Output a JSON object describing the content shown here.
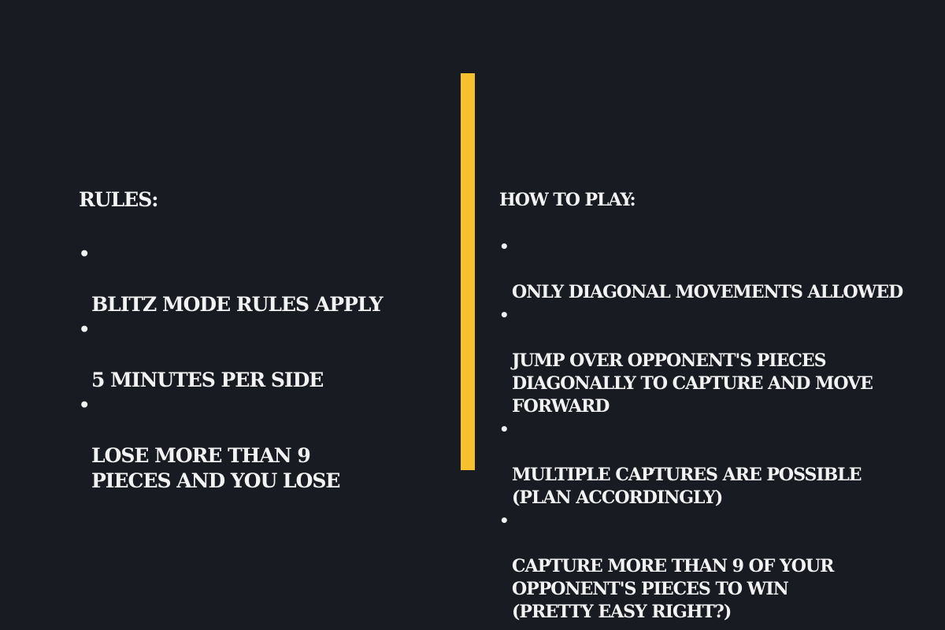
{
  "colors": {
    "background": "#181b21",
    "text": "#f2f2f2",
    "accent": "#f6c12c"
  },
  "rules": {
    "heading": "RULES:",
    "items": [
      "BLITZ MODE RULES APPLY",
      "5 MINUTES PER SIDE",
      "LOSE MORE THAN 9\nPIECES AND YOU LOSE"
    ]
  },
  "how_to_play": {
    "heading": "HOW TO PLAY:",
    "items": [
      "ONLY DIAGONAL MOVEMENTS ALLOWED",
      "JUMP OVER OPPONENT'S PIECES\nDIAGONALLY TO CAPTURE AND MOVE\nFORWARD",
      "MULTIPLE CAPTURES ARE POSSIBLE\n(PLAN ACCORDINGLY)",
      "CAPTURE MORE THAN 9 OF YOUR\nOPPONENT'S PIECES TO WIN\n(PRETTY EASY RIGHT?)"
    ]
  },
  "bullet_glyph": "•"
}
